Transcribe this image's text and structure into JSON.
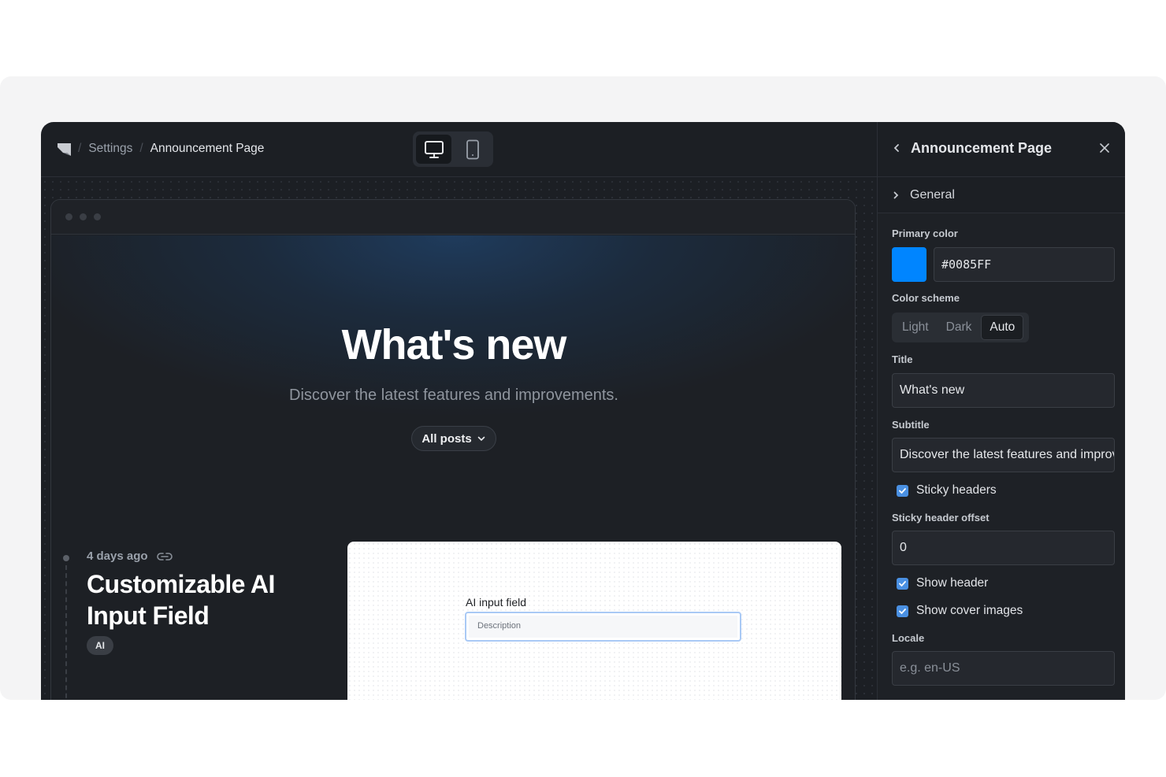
{
  "breadcrumb": {
    "items": [
      "Settings",
      "Announcement Page"
    ],
    "separator": "/"
  },
  "device_toggle": {
    "options": [
      "desktop",
      "tablet"
    ],
    "selected": "desktop"
  },
  "preview": {
    "hero_title": "What's new",
    "hero_subtitle": "Discover the latest features and improvements.",
    "filter_label": "All posts",
    "post": {
      "date": "4 days ago",
      "title": "Customizable AI Input Field",
      "tag": "AI",
      "cover": {
        "field_label": "AI input field",
        "field_placeholder": "Description"
      }
    }
  },
  "panel": {
    "title": "Announcement Page",
    "section": "General",
    "primary_color": {
      "label": "Primary color",
      "value": "#0085FF"
    },
    "color_scheme": {
      "label": "Color scheme",
      "options": [
        "Light",
        "Dark",
        "Auto"
      ],
      "selected": "Auto"
    },
    "title_field": {
      "label": "Title",
      "value": "What's new"
    },
    "subtitle_field": {
      "label": "Subtitle",
      "value": "Discover the latest features and improvements."
    },
    "sticky_headers": {
      "label": "Sticky headers",
      "checked": true
    },
    "sticky_offset": {
      "label": "Sticky header offset",
      "value": "0"
    },
    "show_header": {
      "label": "Show header",
      "checked": true
    },
    "show_cover": {
      "label": "Show cover images",
      "checked": true
    },
    "locale": {
      "label": "Locale",
      "placeholder": "e.g. en-US"
    }
  },
  "colors": {
    "accent": "#0085FF",
    "app_bg": "#1c1f24",
    "checkbox": "#4a90e2"
  }
}
